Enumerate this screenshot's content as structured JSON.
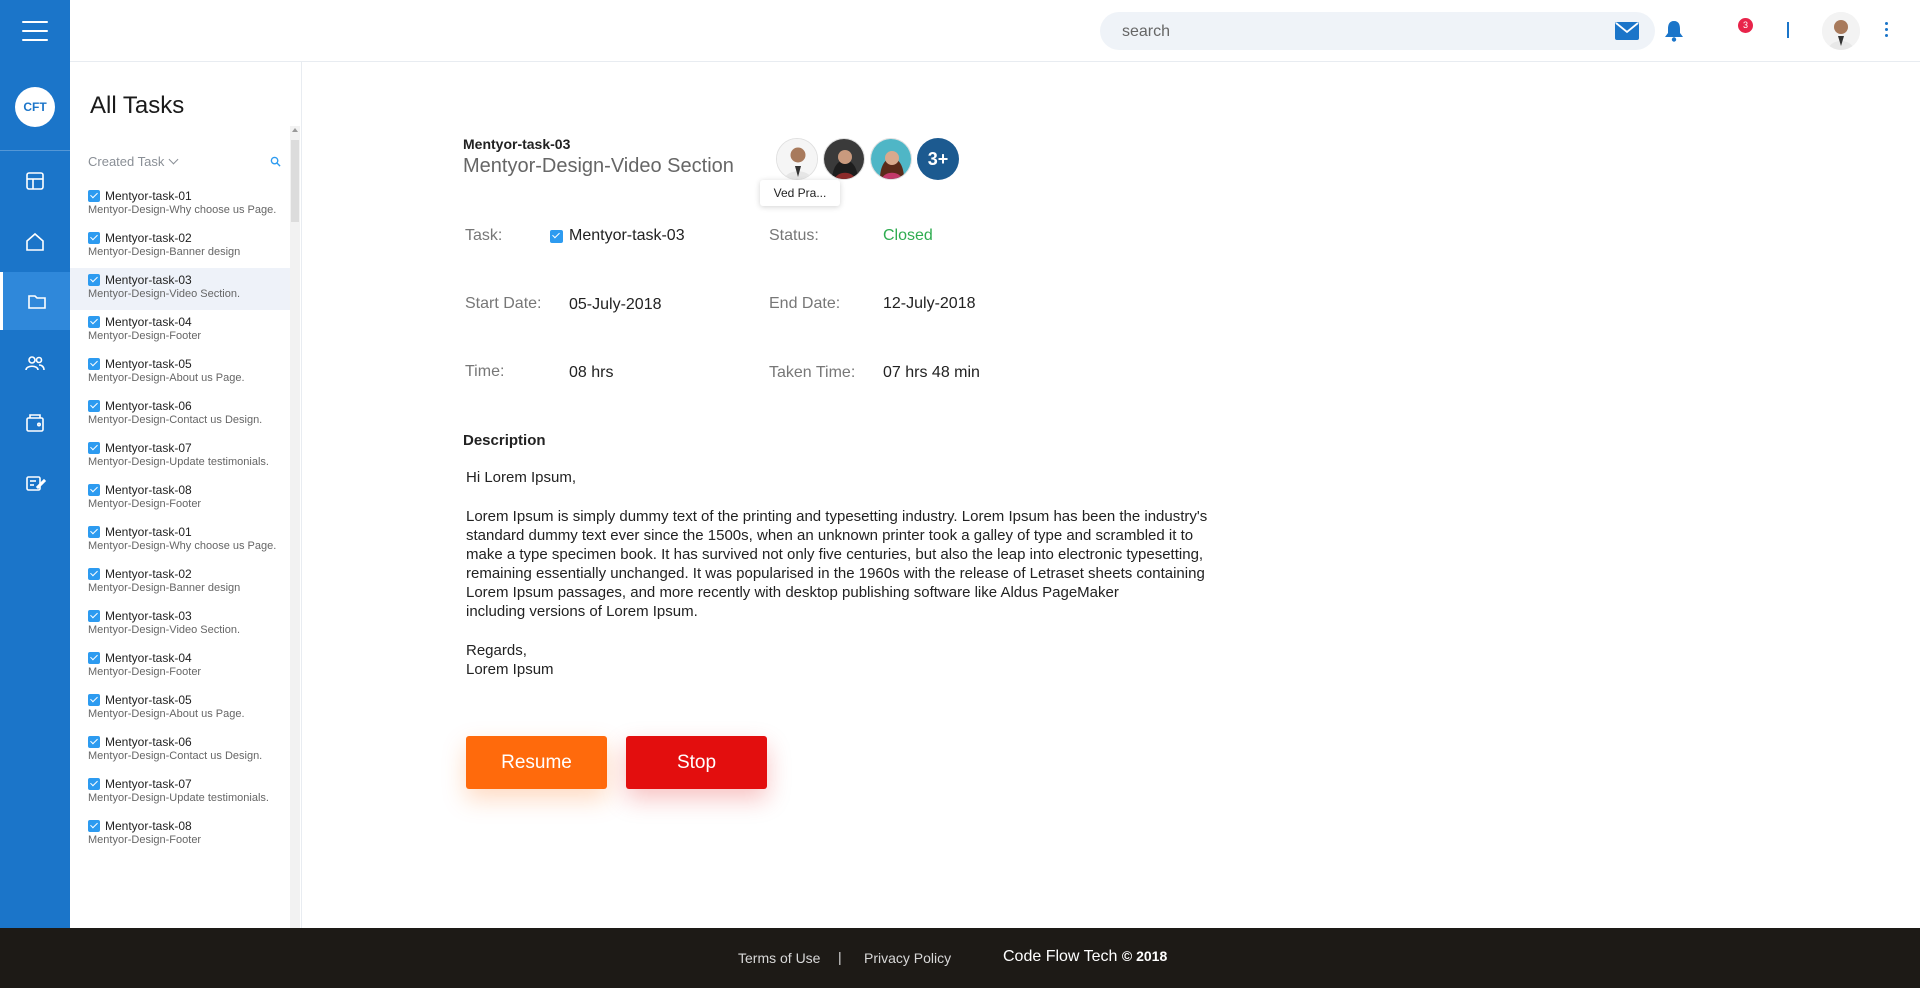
{
  "logo": {
    "text": "CFT"
  },
  "topbar": {
    "search_placeholder": "search",
    "notifications_count": "3"
  },
  "task_list": {
    "heading": "All Tasks",
    "filter_label": "Created Task",
    "items": [
      {
        "code": "Mentyor-task-01",
        "desc": "Mentyor-Design-Why choose us Page."
      },
      {
        "code": "Mentyor-task-02",
        "desc": "Mentyor-Design-Banner design"
      },
      {
        "code": "Mentyor-task-03",
        "desc": "Mentyor-Design-Video Section."
      },
      {
        "code": "Mentyor-task-04",
        "desc": "Mentyor-Design-Footer"
      },
      {
        "code": "Mentyor-task-05",
        "desc": "Mentyor-Design-About us Page."
      },
      {
        "code": "Mentyor-task-06",
        "desc": "Mentyor-Design-Contact us Design."
      },
      {
        "code": "Mentyor-task-07",
        "desc": "Mentyor-Design-Update testimonials."
      },
      {
        "code": "Mentyor-task-08",
        "desc": "Mentyor-Design-Footer"
      },
      {
        "code": "Mentyor-task-01",
        "desc": "Mentyor-Design-Why choose us Page."
      },
      {
        "code": "Mentyor-task-02",
        "desc": "Mentyor-Design-Banner design"
      },
      {
        "code": "Mentyor-task-03",
        "desc": "Mentyor-Design-Video Section."
      },
      {
        "code": "Mentyor-task-04",
        "desc": "Mentyor-Design-Footer"
      },
      {
        "code": "Mentyor-task-05",
        "desc": "Mentyor-Design-About us Page."
      },
      {
        "code": "Mentyor-task-06",
        "desc": "Mentyor-Design-Contact us Design."
      },
      {
        "code": "Mentyor-task-07",
        "desc": "Mentyor-Design-Update testimonials."
      },
      {
        "code": "Mentyor-task-08",
        "desc": "Mentyor-Design-Footer"
      }
    ]
  },
  "task_detail": {
    "code": "Mentyor-task-03",
    "title": "Mentyor-Design-Video Section",
    "assignee_more": "3+",
    "tooltip": "Ved Pra...",
    "task_label": "Task:",
    "task_value": "Mentyor-task-03",
    "status_label": "Status:",
    "status_value": "Closed",
    "start_label": "Start Date:",
    "start_value": "05-July-2018",
    "end_label": "End Date:",
    "end_value": "12-July-2018",
    "time_label": "Time:",
    "time_value": "08 hrs",
    "taken_label": "Taken Time:",
    "taken_value": "07 hrs 48 min",
    "description_heading": "Description",
    "description_greeting": "Hi Lorem Ipsum,",
    "description_body": "Lorem Ipsum is simply dummy text of the printing and typesetting industry. Lorem Ipsum has been the industry's\nstandard dummy text ever since the 1500s, when an unknown printer took a galley of type and scrambled it to\nmake a type specimen book. It has survived not only five centuries, but also the leap into electronic typesetting,\nremaining essentially unchanged. It was popularised in the 1960s with the release of Letraset sheets containing\nLorem Ipsum passages, and more recently with desktop publishing software like Aldus PageMaker\nincluding versions of Lorem Ipsum.",
    "description_signoff": "Regards,\nLorem Ipsum",
    "resume_label": "Resume",
    "stop_label": "Stop"
  },
  "footer": {
    "terms": "Terms of Use",
    "separator": "|",
    "privacy": "Privacy Policy",
    "brand": "Code Flow Tech",
    "copyright": "© 2018"
  },
  "colors": {
    "primary": "#1b75c9",
    "resume": "#ff6a0c",
    "stop": "#e30e0e",
    "status_closed": "#2eac50",
    "footer_bg": "#1d1a16"
  }
}
